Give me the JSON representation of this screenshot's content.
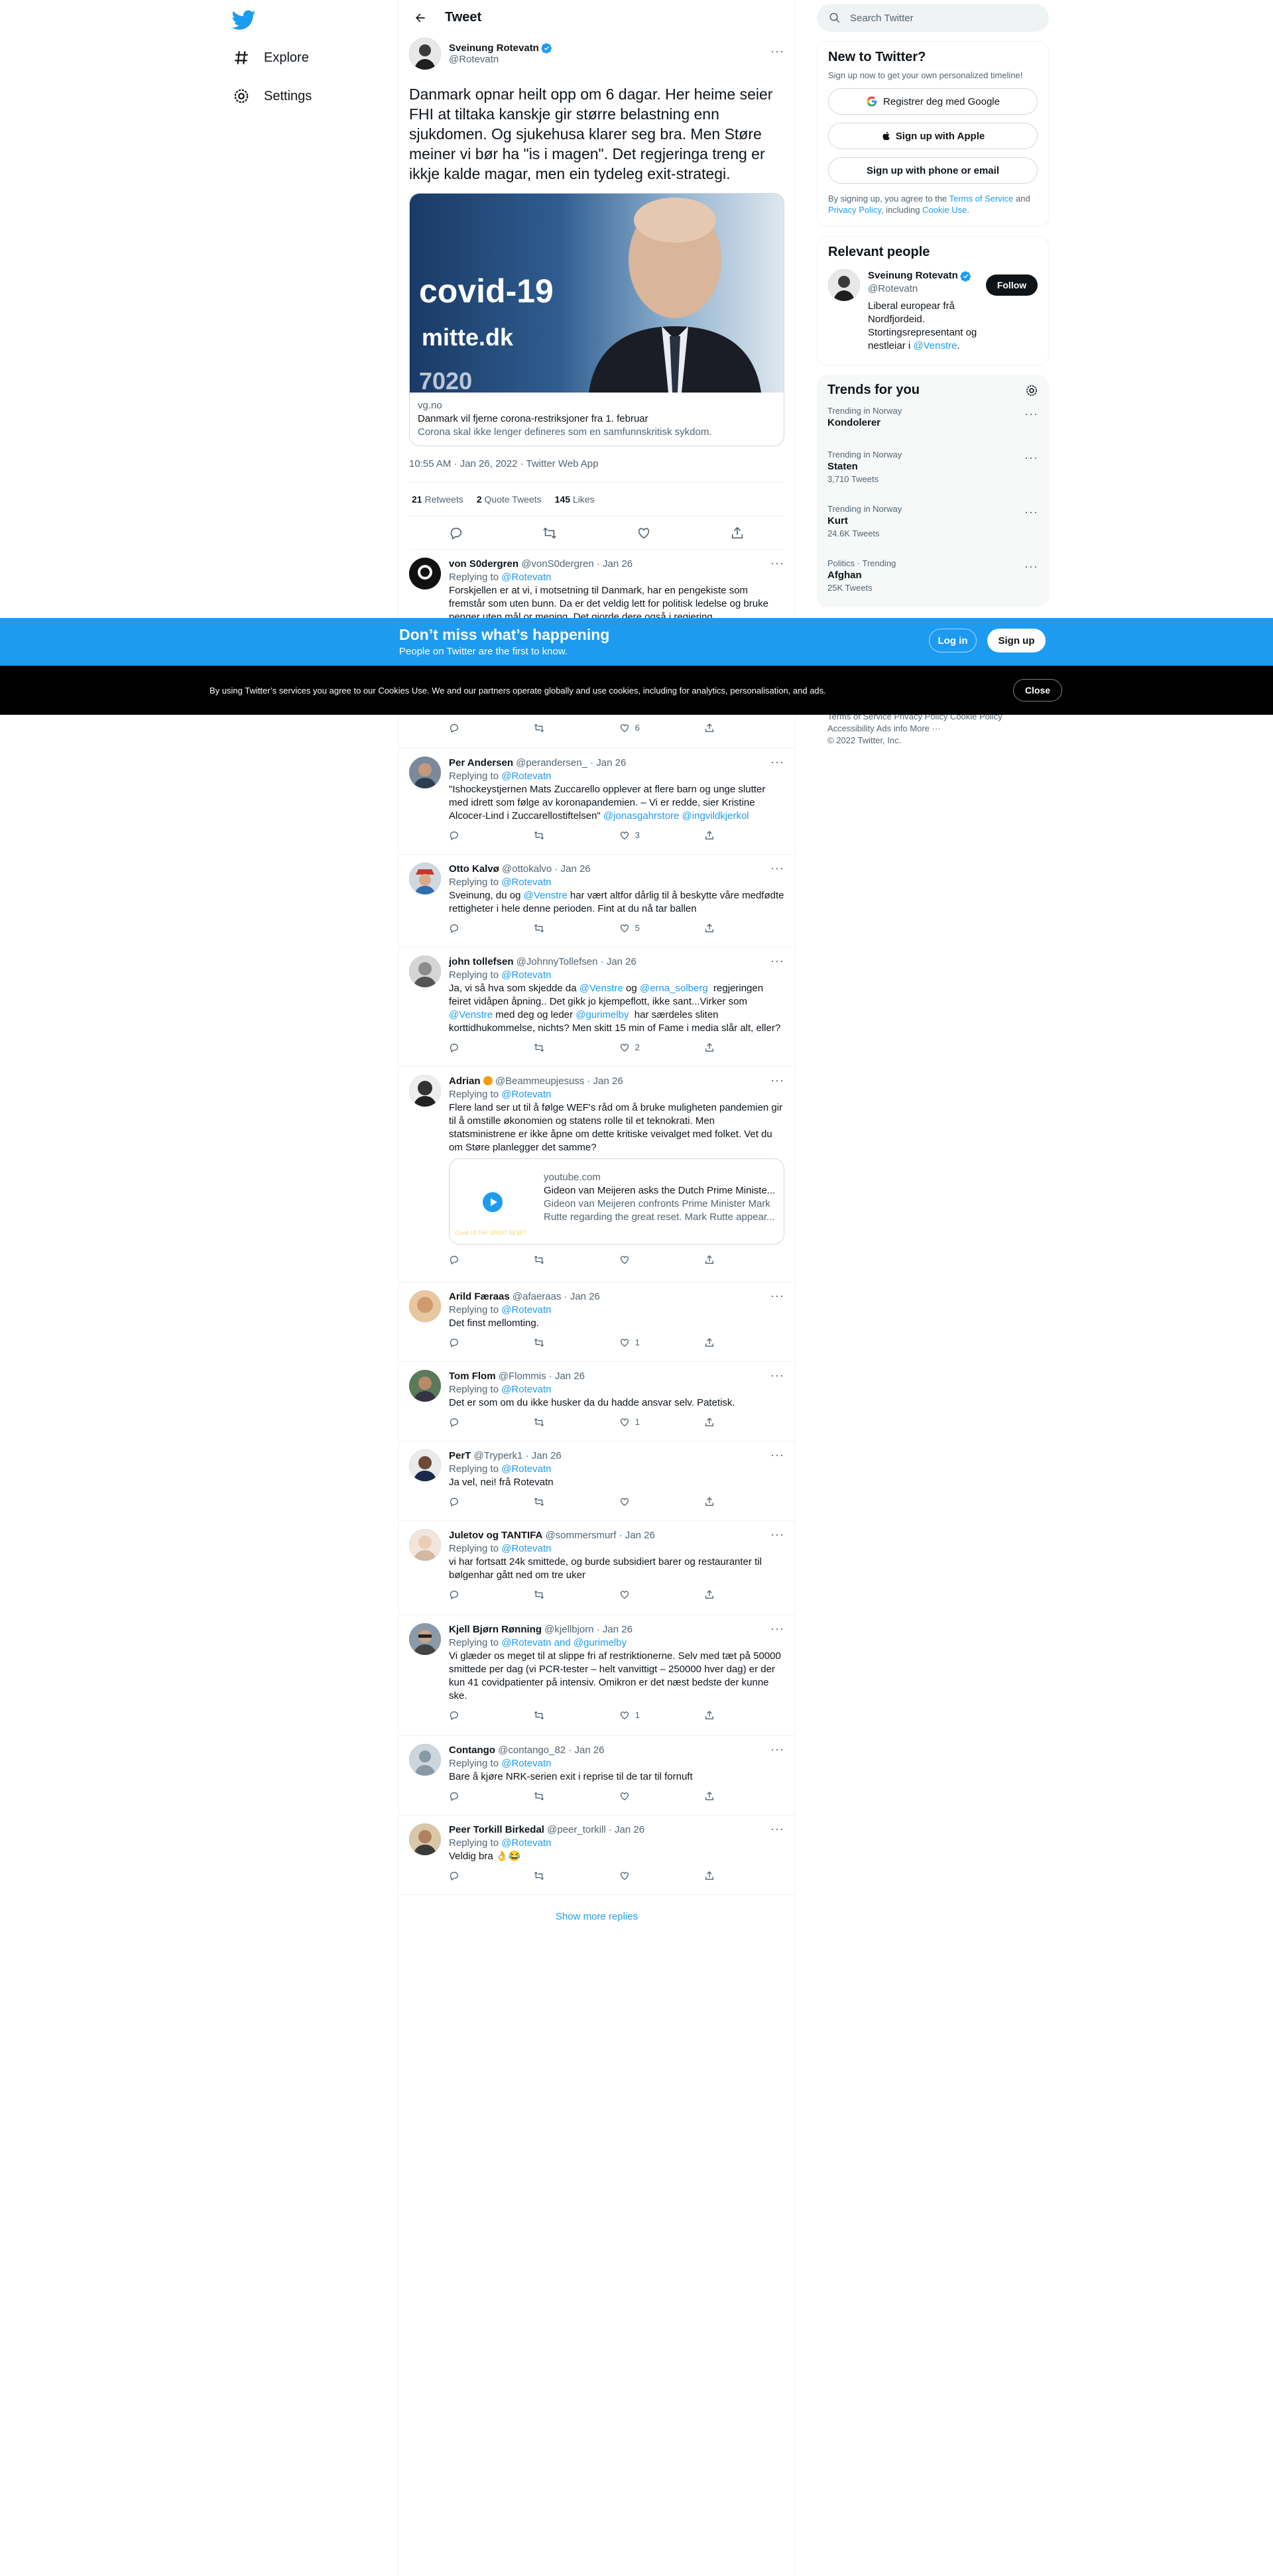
{
  "nav": {
    "explore": "Explore",
    "settings": "Settings"
  },
  "header": {
    "title": "Tweet"
  },
  "main_tweet": {
    "author_name": "Sveinung Rotevatn",
    "handle": "@Rotevatn",
    "text": "Danmark opnar heilt opp om 6 dagar. Her heime seier FHI at tiltaka kanskje gir større belastning enn sjukdomen. Og sjukehusa klarer seg bra. Men Støre meiner vi bør ha \"is i magen\". Det regjeringa treng er ikkje kalde magar, men ein tydeleg exit-strategi.",
    "card": {
      "image_text_1": "covid-19",
      "image_text_2": "mitte.dk",
      "image_text_3": "7020",
      "domain": "vg.no",
      "title": "Danmark vil fjerne corona-restriksjoner fra 1. februar",
      "description": "Corona skal ikke lenger defineres som en samfunnskritisk sykdom."
    },
    "time": "10:55 AM · Jan 26, 2022 · Twitter Web App",
    "retweets": "21",
    "retweets_label": "Retweets",
    "quotes": "2",
    "quotes_label": "Quote Tweets",
    "likes": "145",
    "likes_label": "Likes"
  },
  "replies": [
    {
      "name": "von S0dergren",
      "handle": "@vonS0dergren",
      "date": "· Jan 26",
      "replying": "Replying to",
      "to": "@Rotevatn",
      "text": "Forskjellen er at vi, i motsetning til Danmark, har en pengekiste som fremstår som uten bunn. Da er det veldig lett for politisk ledelse og bruke penger uten mål or mening. Det gjorde dere også i regjering.",
      "likes": "6"
    },
    {
      "name": "Per Andersen",
      "handle": "@perandersen_",
      "date": "· Jan 26",
      "replying": "Replying to",
      "to": "@Rotevatn",
      "text": "\"Ishockeystjernen Mats Zuccarello opplever at flere barn og unge slutter med idrett som følge av koronapandemien. – Vi er redde, sier Kristine Alcocer-Lind i Zuccarellostiftelsen\" ",
      "mention2": "@jonasgahrstore @ingvildkjerkol",
      "likes": "3"
    },
    {
      "name": "Otto Kalvø",
      "handle": "@ottokalvo",
      "date": "· Jan 26",
      "replying": "Replying to",
      "to": "@Rotevatn",
      "text_a": "Sveinung, du og ",
      "mention": "@Venstre",
      "text_b": " har vært altfor dårlig til å beskytte våre medfødte rettigheter i hele denne perioden. Fint at du nå tar ballen",
      "likes": "5"
    },
    {
      "name": "john tollefsen",
      "handle": "@JohnnyTollefsen",
      "date": "· Jan 26",
      "replying": "Replying to",
      "to": "@Rotevatn",
      "text_a": "Ja, vi så hva som skjedde da ",
      "m1": "@Venstre",
      "text_b": " og ",
      "m2": "@erna_solberg",
      "text_c": "  regjeringen feiret vidåpen åpning.. Det gikk jo kjempeflott, ikke sant...Virker som ",
      "m3": "@Venstre",
      "text_d": " med deg og leder ",
      "m4": "@gurimelby",
      "text_e": "  har særdeles sliten korttidhukommelse, nichts? Men skitt 15 min of Fame i media slår alt, eller?",
      "likes": "2"
    },
    {
      "name": "Adrian",
      "handle": "@Beammeupjesuss",
      "date": "· Jan 26",
      "replying": "Replying to",
      "to": "@Rotevatn",
      "text": "Flere land ser ut til å følge WEF's råd om å bruke muligheten pandemien gir til å omstille økonomien og statens rolle til et teknokrati. Men statsministrene er ikke åpne om dette kritiske veivalget med folket. Vet du om Støre planlegger det samme?",
      "card_domain": "youtube.com",
      "card_title": "Gideon van Meijeren asks the Dutch Prime Ministe...",
      "card_desc": "Gideon van Meijeren confronts Prime Minister Mark Rutte regarding the great reset. Mark Rutte appear...",
      "thumb_caption": "Covid-19 THE GREAT RESET"
    },
    {
      "name": "Arild Færaas",
      "handle": "@afaeraas",
      "date": "· Jan 26",
      "replying": "Replying to",
      "to": "@Rotevatn",
      "text": "Det finst mellomting.",
      "likes": "1"
    },
    {
      "name": "Tom Flom",
      "handle": "@Flommis",
      "date": "· Jan 26",
      "replying": "Replying to",
      "to": "@Rotevatn",
      "text": "Det er som om du ikke husker da du hadde ansvar selv. Patetisk.",
      "likes": "1"
    },
    {
      "name": "PerT",
      "handle": "@Tryperk1",
      "date": "· Jan 26",
      "replying": "Replying to",
      "to": "@Rotevatn",
      "text": "Ja vel, nei! frå Rotevatn"
    },
    {
      "name": "Juletov og TANTIFA",
      "handle": "@sommersmurf",
      "date": "· Jan 26",
      "replying": "Replying to",
      "to": "@Rotevatn",
      "text": "vi har fortsatt 24k smittede, og burde subsidiert barer og restauranter til bølgenhar gått ned om tre uker"
    },
    {
      "name": "Kjell Bjørn Rønning",
      "handle": "@kjellbjorn",
      "date": "· Jan 26",
      "replying": "Replying to",
      "to": "@Rotevatn and @gurimelby",
      "text": "Vi glæder os meget til at slippe fri af restriktionerne. Selv med tæt på 50000 smittede per dag (vi PCR-tester – helt vanvittigt – 250000 hver dag) er der kun 41 covidpatienter på intensiv. Omikron er det næst bedste der kunne ske.",
      "likes": "1"
    },
    {
      "name": "Contango",
      "handle": "@contango_82",
      "date": "· Jan 26",
      "replying": "Replying to",
      "to": "@Rotevatn",
      "text": "Bare å kjøre NRK-serien exit i reprise til de tar til fornuft"
    },
    {
      "name": "Peer Torkill Birkedal",
      "handle": "@peer_torkill",
      "date": "· Jan 26",
      "replying": "Replying to",
      "to": "@Rotevatn",
      "text": "Veldig bra 👌😂"
    }
  ],
  "show_more": "Show more replies",
  "search": {
    "placeholder": "Search Twitter"
  },
  "new_to_twitter": {
    "title": "New to Twitter?",
    "sub": "Sign up now to get your own personalized timeline!",
    "google": "Registrer deg med Google",
    "apple": "Sign up with Apple",
    "phone": "Sign up with phone or email",
    "terms_a": "By signing up, you agree to the ",
    "terms_link": "Terms of Service",
    "terms_b": " and ",
    "privacy_link": "Privacy Policy",
    "terms_c": ", including ",
    "cookie_link": "Cookie Use",
    "terms_d": "."
  },
  "relevant": {
    "title": "Relevant people",
    "name": "Sveinung Rotevatn",
    "handle": "@Rotevatn",
    "follow": "Follow",
    "bio": "Liberal europear frå Nordfjordeid. Stortingsrepresentant og nestleiar i ",
    "bio_link": "@Venstre",
    "bio_end": "."
  },
  "trends": {
    "title": "Trends for you",
    "items": [
      {
        "cat": "Trending in Norway",
        "name": "Kondolerer",
        "count": ""
      },
      {
        "cat": "Trending in Norway",
        "name": "Staten",
        "count": "3,710 Tweets"
      },
      {
        "cat": "Trending in Norway",
        "name": "Kurt",
        "count": "24.6K Tweets"
      },
      {
        "cat": "Politics · Trending",
        "name": "Afghan",
        "count": "25K Tweets"
      }
    ]
  },
  "footer": {
    "links": "Terms of Service   Privacy Policy   Cookie Policy",
    "links2": "Accessibility   Ads info   More ···",
    "copyright": "© 2022 Twitter, Inc."
  },
  "signup_bar": {
    "title": "Don’t miss what’s happening",
    "sub": "People on Twitter are the first to know.",
    "login": "Log in",
    "signup": "Sign up"
  },
  "cookie_bar": {
    "text": "By using Twitter’s services you agree to our Cookies Use. We and our partners operate globally and use cookies, including for analytics, personalisation, and ads.",
    "close": "Close"
  },
  "colors": {
    "accent": "#1d9bf0",
    "text": "#0f1419",
    "muted": "#536471"
  }
}
